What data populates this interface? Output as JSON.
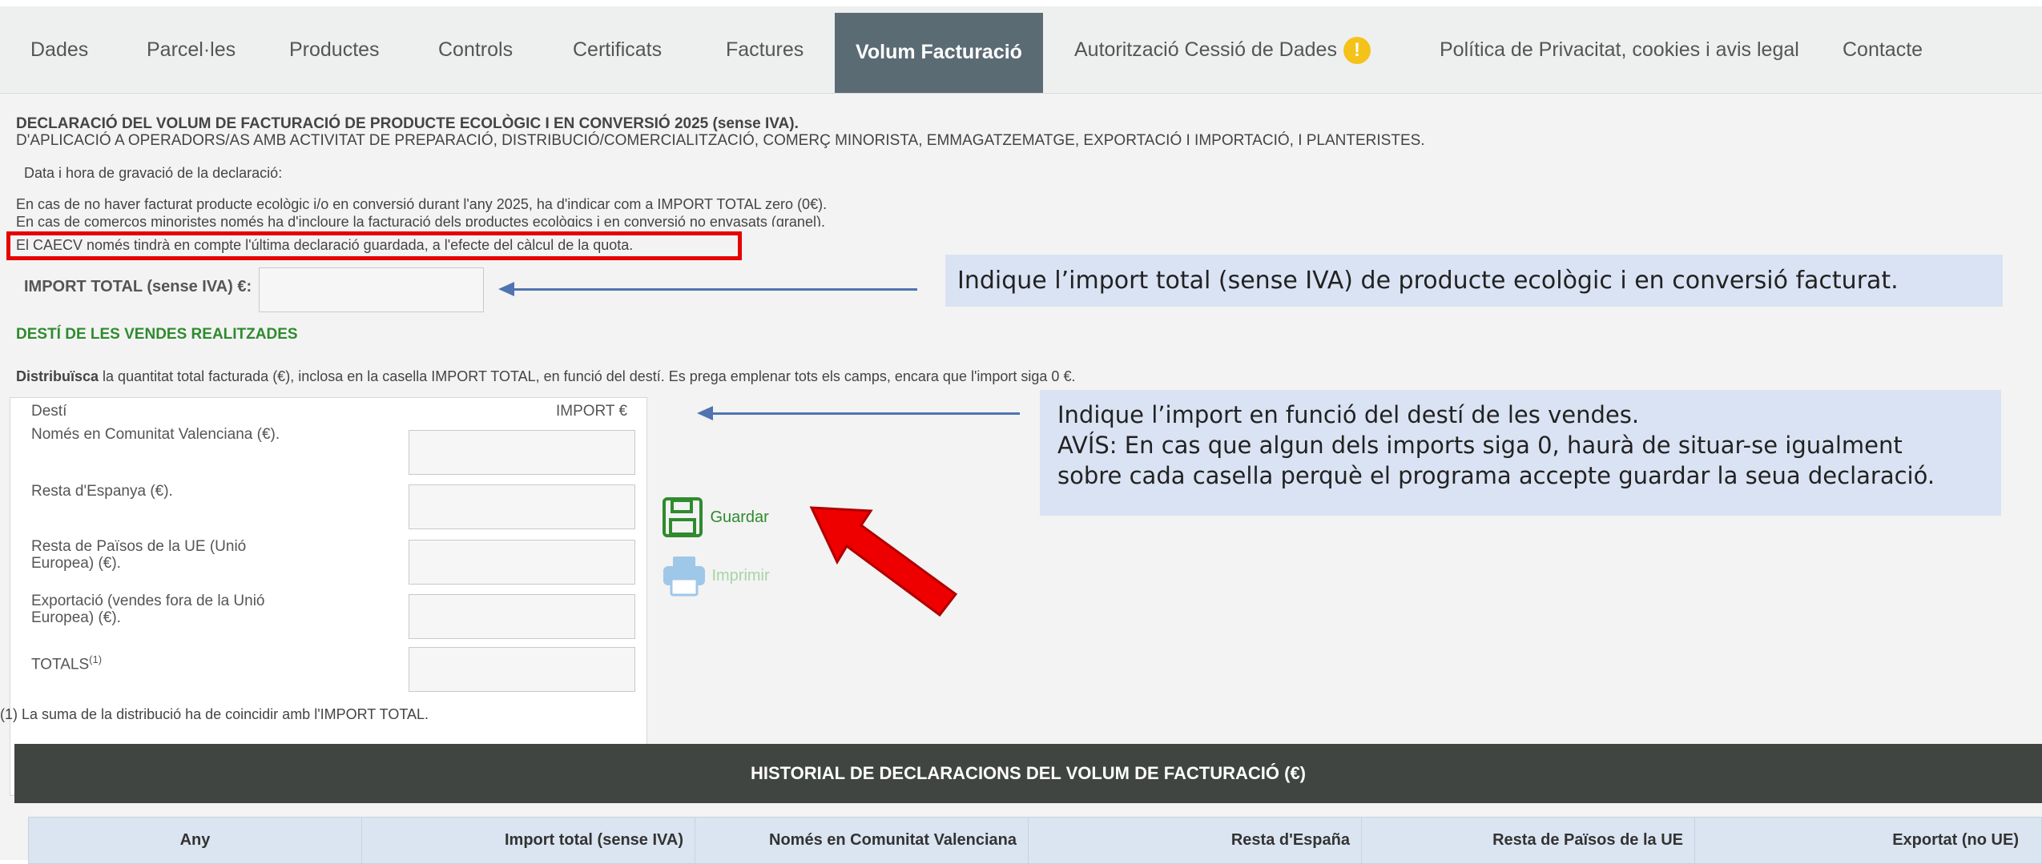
{
  "nav": {
    "items": [
      {
        "label": "Dades"
      },
      {
        "label": "Parcel·les"
      },
      {
        "label": "Productes"
      },
      {
        "label": "Controls"
      },
      {
        "label": "Certificats"
      },
      {
        "label": "Factures"
      },
      {
        "label": "Volum Facturació"
      },
      {
        "label": "Autorització Cessió de Dades"
      },
      {
        "label": "Política de Privacitat, cookies i avis legal"
      },
      {
        "label": "Contacte"
      }
    ],
    "active": "Volum Facturació",
    "warning_badge": "!"
  },
  "declaration": {
    "title": "DECLARACIÓ DEL VOLUM DE FACTURACIÓ DE PRODUCTE ECOLÒGIC I EN CONVERSIÓ 2025 (sense IVA).",
    "subtitle": "D'APLICACIÓ A OPERADORS/AS AMB ACTIVITAT DE PREPARACIÓ, DISTRIBUCIÓ/COMERCIALITZACIÓ, COMERÇ MINORISTA, EMMAGATZEMATGE, EXPORTACIÓ I IMPORTACIÓ, I PLANTERISTES.",
    "date_label": "Data i hora de gravació de la declaració:",
    "note1": "En cas de no haver facturat producte ecològic i/o en conversió durant l'any 2025, ha d'indicar com a IMPORT TOTAL zero (0€).",
    "note2": "En cas de comerços minoristes només ha d'incloure la facturació dels productes ecològics i en conversió no envasats (granel).",
    "note3": "El CAECV només tindrà en compte l'última declaració guardada, a l'efecte del càlcul de la quota.",
    "import_total_label": "IMPORT TOTAL (sense IVA) €:",
    "import_total_value": ""
  },
  "callouts": {
    "total": "Indique l’import total (sense IVA) de producte ecològic i en conversió facturat.",
    "dest_line1": "Indique l’import en funció del destí de les vendes.",
    "dest_line2": "AVÍS: En cas que algun dels imports siga 0, haurà de situar-se igualment",
    "dest_line3": "sobre cada casella perquè el programa accepte guardar la seua declaració."
  },
  "destinations": {
    "section_title": "DESTÍ DE LES VENDES REALITZADES",
    "instr_bold": "Distribuïsca",
    "instr_rest": " la quantitat total facturada (€), inclosa en la casella IMPORT TOTAL, en funció del destí. Es prega emplenar tots els camps, encara que l'import siga 0 €.",
    "col_dest": "Destí",
    "col_import": "IMPORT €",
    "rows": [
      {
        "label": "Només en Comunitat Valenciana (€).",
        "value": ""
      },
      {
        "label": "Resta d'Espanya (€).",
        "value": ""
      },
      {
        "label_1": "Resta de Països de la UE (Unió",
        "label_2": "Europea) (€).",
        "value": ""
      },
      {
        "label_1": "Exportació (vendes fora de la Unió",
        "label_2": "Europea) (€).",
        "value": ""
      },
      {
        "label": "TOTALS",
        "sup": "(1)",
        "value": ""
      }
    ],
    "footnote": "(1) La suma de la distribució ha de coincidir amb l'IMPORT TOTAL."
  },
  "actions": {
    "save": "Guardar",
    "print": "Imprimir"
  },
  "history": {
    "title": "HISTORIAL DE DECLARACIONS DEL VOLUM DE FACTURACIÓ (€)",
    "columns": [
      "Any",
      "Import total (sense IVA)",
      "Només en Comunitat Valenciana",
      "Resta d'España",
      "Resta de Països de la UE",
      "Exportat (no UE)"
    ]
  },
  "colors": {
    "nav_active": "#5b6b74",
    "highlight_red": "#e60000",
    "green_accent": "#2e8b2e",
    "callout_bg": "#dae3f3",
    "arrow_blue": "#4f74b0",
    "history_header": "#404541"
  }
}
